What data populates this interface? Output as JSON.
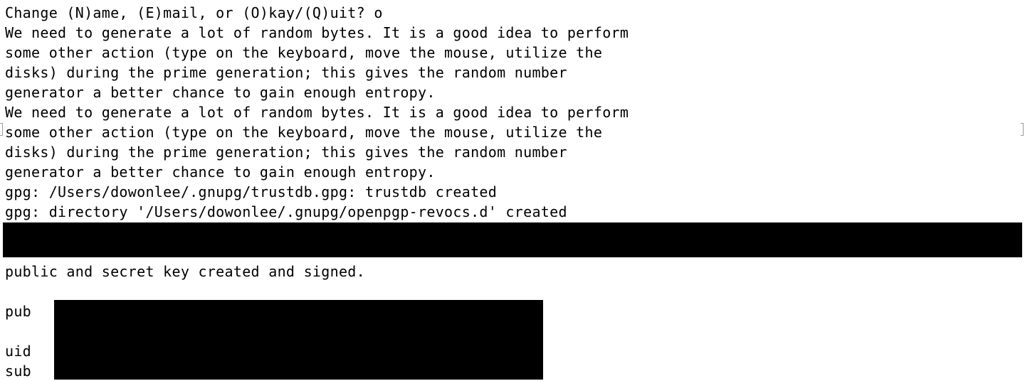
{
  "terminal": {
    "lines": [
      "Change (N)ame, (E)mail, or (O)kay/(Q)uit? o",
      "We need to generate a lot of random bytes. It is a good idea to perform",
      "some other action (type on the keyboard, move the mouse, utilize the",
      "disks) during the prime generation; this gives the random number",
      "generator a better chance to gain enough entropy.",
      "We need to generate a lot of random bytes. It is a good idea to perform",
      "some other action (type on the keyboard, move the mouse, utilize the",
      "disks) during the prime generation; this gives the random number",
      "generator a better chance to gain enough entropy.",
      "gpg: /Users/dowonlee/.gnupg/trustdb.gpg: trustdb created",
      "gpg: directory '/Users/dowonlee/.gnupg/openpgp-revocs.d' created"
    ],
    "after_redaction": "public and secret key created and signed.",
    "key_labels": {
      "pub": "pub",
      "uid": "uid",
      "sub": "sub"
    }
  }
}
